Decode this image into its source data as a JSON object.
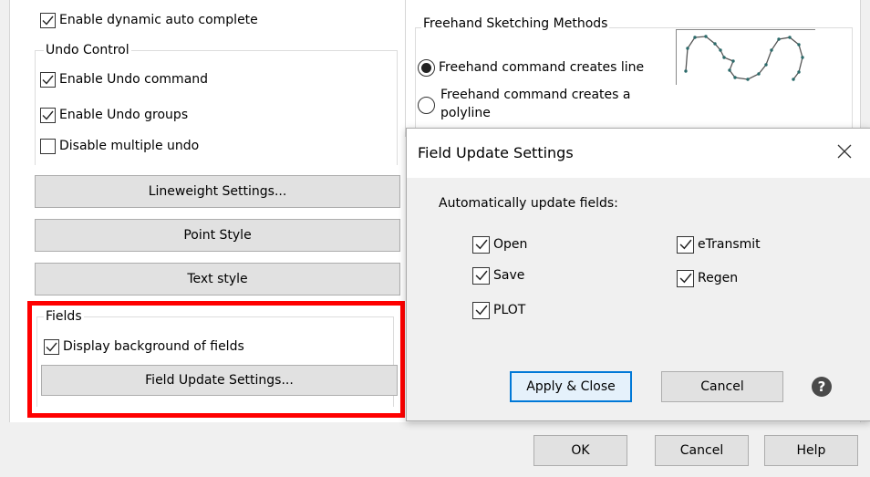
{
  "options": {
    "dynamic_auto_complete": {
      "label": "Enable dynamic auto complete",
      "checked": true
    },
    "undo_control": {
      "title": "Undo Control",
      "enable_undo_command": {
        "label": "Enable Undo command",
        "checked": true
      },
      "enable_undo_groups": {
        "label": "Enable Undo groups",
        "checked": true
      },
      "disable_multiple_undo": {
        "label": "Disable multiple undo",
        "checked": false
      }
    },
    "buttons": {
      "lineweight": "Lineweight Settings...",
      "point_style": "Point Style",
      "text_style": "Text style"
    },
    "fields": {
      "title": "Fields",
      "display_background": {
        "label": "Display  background of fields",
        "checked": true
      },
      "update_settings_button": "Field Update Settings..."
    },
    "freehand": {
      "title": "Freehand Sketching Methods",
      "creates_lines": {
        "label": "Freehand command creates line",
        "selected": true
      },
      "creates_polyline": {
        "label_line1": "Freehand command creates a",
        "label_line2": "polyline",
        "selected": false
      }
    },
    "footer": {
      "ok": "OK",
      "cancel": "Cancel",
      "help": "Help"
    }
  },
  "dialog": {
    "title": "Field Update Settings",
    "prompt": "Automatically update fields:",
    "checks": {
      "open": {
        "label": "Open",
        "checked": true
      },
      "save": {
        "label": "Save",
        "checked": true
      },
      "plot": {
        "label": "PLOT",
        "checked": true
      },
      "etransmit": {
        "label": "eTransmit",
        "checked": true
      },
      "regen": {
        "label": "Regen",
        "checked": true
      }
    },
    "apply_close": "Apply & Close",
    "cancel": "Cancel"
  },
  "colors": {
    "highlight_border": "#ff0000",
    "focus_button_border": "#0078d7",
    "focus_button_bg": "#e5f1fb"
  }
}
